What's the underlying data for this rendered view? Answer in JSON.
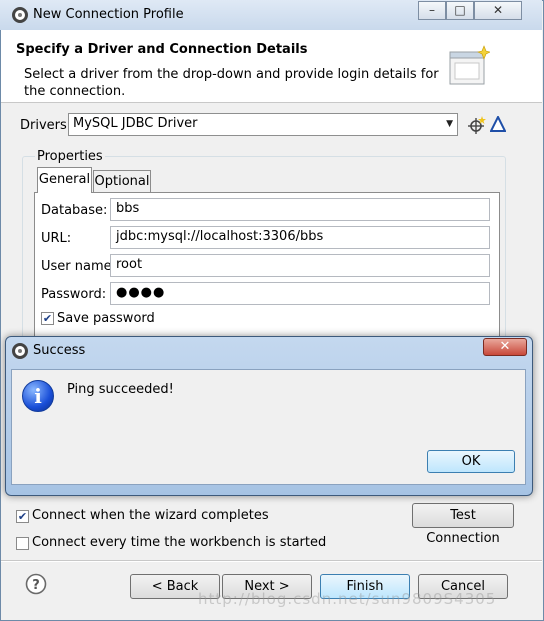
{
  "window": {
    "title": "New Connection Profile",
    "minimize_glyph": "–",
    "maximize_glyph": "□",
    "close_glyph": "✕"
  },
  "header": {
    "title": "Specify a Driver and Connection Details",
    "description": "Select a driver from the drop-down and provide login details for the connection."
  },
  "drivers": {
    "label": "Drivers:",
    "selected": "MySQL JDBC Driver",
    "new_driver_icon": "new-driver-icon",
    "edit_driver_icon": "edit-driver-icon"
  },
  "properties": {
    "group_label": "Properties",
    "tabs": [
      "General",
      "Optional"
    ],
    "active_tab": "General",
    "fields": [
      {
        "label": "Database:",
        "value": "bbs"
      },
      {
        "label": "URL:",
        "value": "jdbc:mysql://localhost:3306/bbs"
      },
      {
        "label": "User name:",
        "value": "root"
      },
      {
        "label": "Password:",
        "value": "●●●●"
      }
    ],
    "save_password": {
      "label": "Save password",
      "checked": true
    }
  },
  "options": {
    "connect_on_finish": {
      "label": "Connect when the wizard completes",
      "checked": true
    },
    "connect_every_time": {
      "label": "Connect every time the workbench is started",
      "checked": false
    },
    "test_connection_label": "Test Connection"
  },
  "footer": {
    "help_icon": "help-icon",
    "back_label": "< Back",
    "next_label": "Next >",
    "finish_label": "Finish",
    "cancel_label": "Cancel",
    "watermark": "http://blog.csdn.net/sun9809S4305"
  },
  "dialog": {
    "title": "Success",
    "message": "Ping succeeded!",
    "ok_label": "OK",
    "close_glyph": "✕",
    "icon": "info-icon"
  },
  "colors": {
    "accent": "#3c7fb1",
    "dialog_frame": "#a6c3e4",
    "close_button": "#c8483a"
  }
}
